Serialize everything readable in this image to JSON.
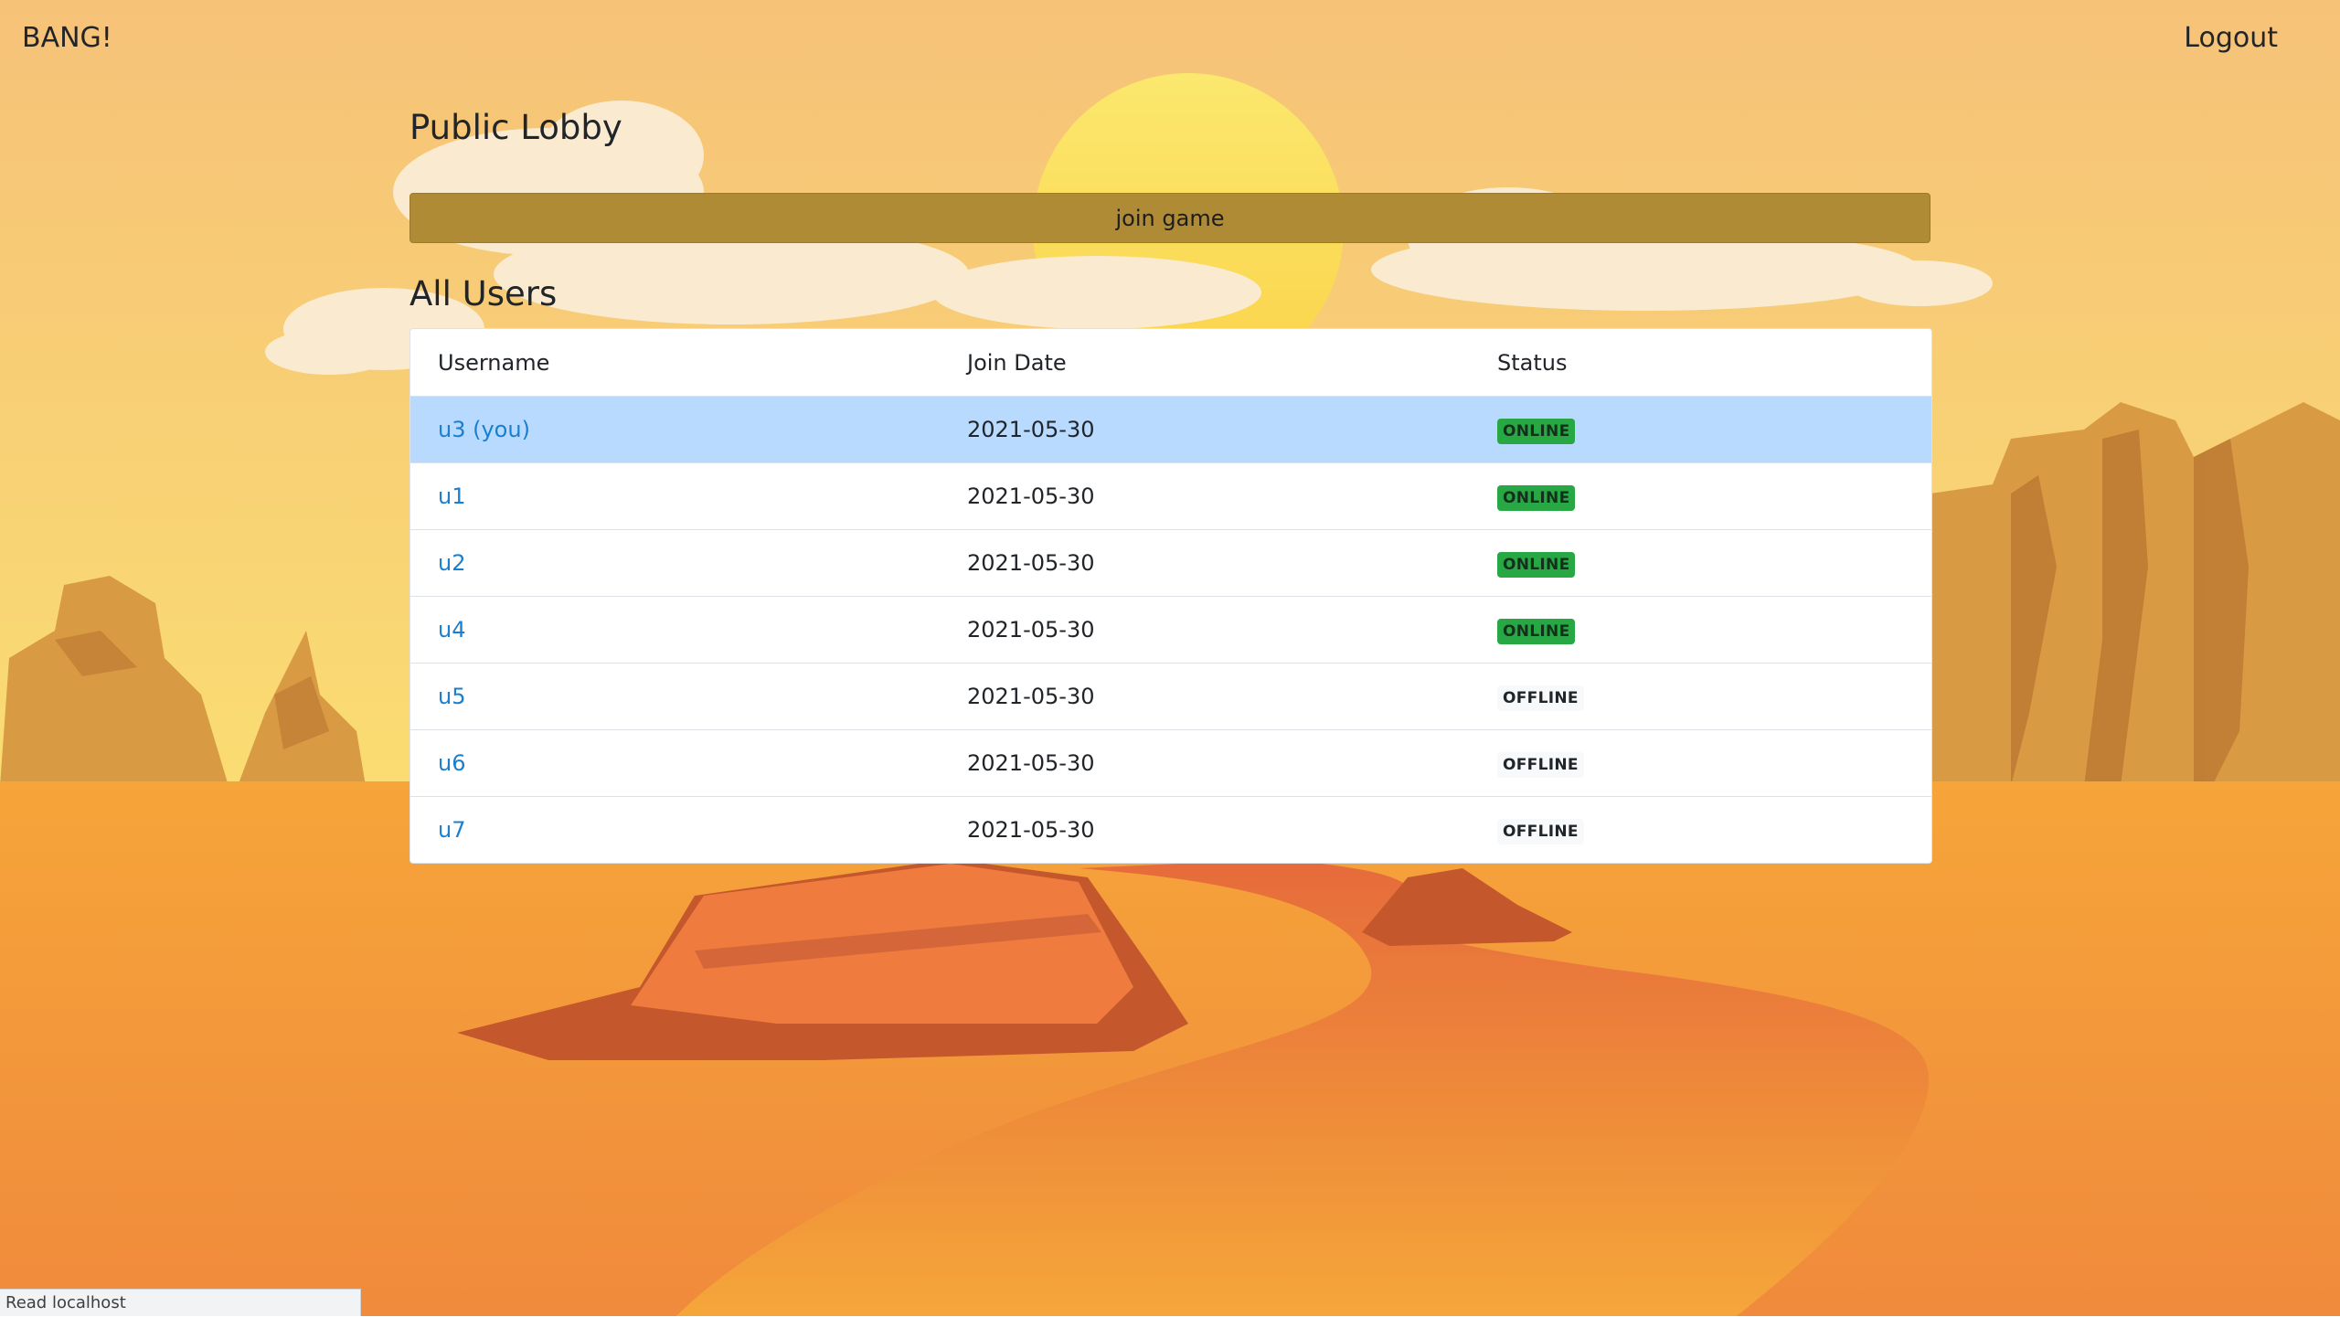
{
  "navbar": {
    "brand": "BANG!",
    "logout_label": "Logout"
  },
  "lobby": {
    "title": "Public Lobby",
    "join_label": "join game"
  },
  "users": {
    "title": "All Users",
    "columns": [
      "Username",
      "Join Date",
      "Status"
    ],
    "rows": [
      {
        "username": "u3 (you)",
        "join_date": "2021-05-30",
        "status": "ONLINE",
        "current": true
      },
      {
        "username": "u1",
        "join_date": "2021-05-30",
        "status": "ONLINE"
      },
      {
        "username": "u2",
        "join_date": "2021-05-30",
        "status": "ONLINE"
      },
      {
        "username": "u4",
        "join_date": "2021-05-30",
        "status": "ONLINE"
      },
      {
        "username": "u5",
        "join_date": "2021-05-30",
        "status": "OFFLINE"
      },
      {
        "username": "u6",
        "join_date": "2021-05-30",
        "status": "OFFLINE"
      },
      {
        "username": "u7",
        "join_date": "2021-05-30",
        "status": "OFFLINE"
      }
    ]
  },
  "browser_status": "Read localhost",
  "colors": {
    "sky": "#f6c278",
    "sun": "#fbe36a",
    "sand": "#f6a53a",
    "road": "#e8693a",
    "join_button": "#b08b36",
    "active_row": "#b8daff",
    "link": "#1a7fd0",
    "online_badge": "#28a745"
  }
}
